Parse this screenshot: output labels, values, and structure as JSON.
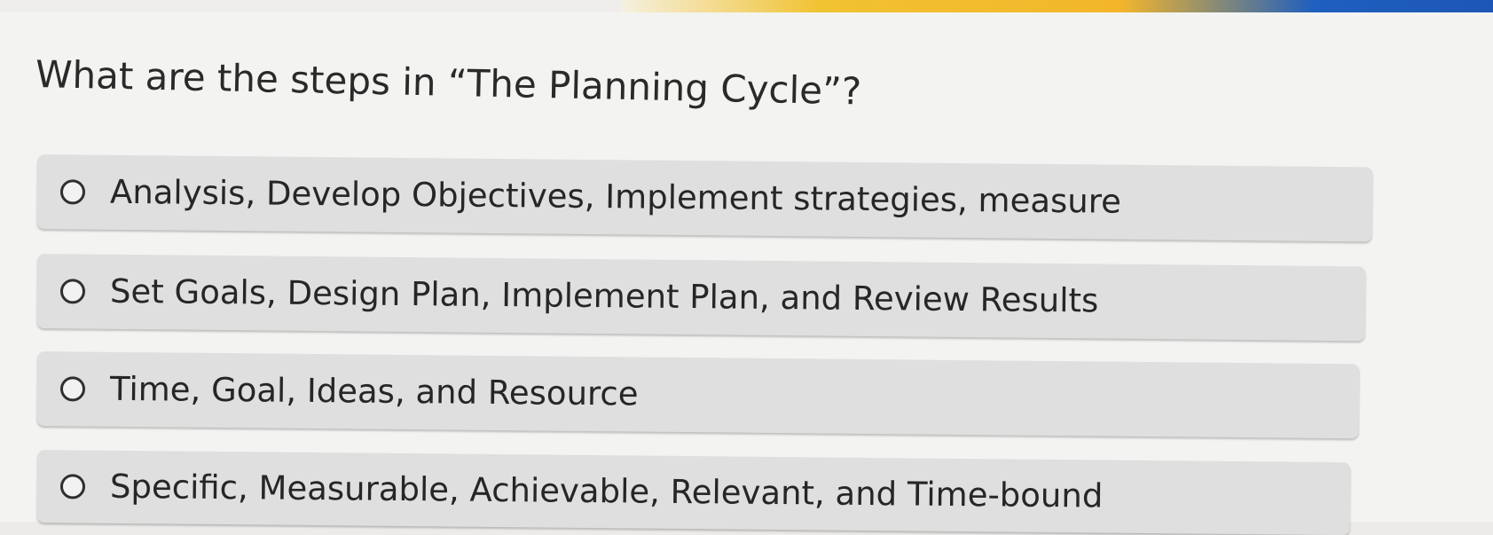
{
  "question": {
    "text": "What are the steps in “The Planning Cycle”?"
  },
  "options": [
    {
      "label": "Analysis, Develop Objectives, Implement strategies, measure"
    },
    {
      "label": "Set Goals, Design Plan, Implement Plan, and Review Results"
    },
    {
      "label": "Time, Goal, Ideas, and Resource"
    },
    {
      "label": "Specific, Measurable, Achievable, Relevant, and Time-bound"
    }
  ],
  "colors": {
    "background": "#f3f3f1",
    "option_background": "#dfdfdf",
    "text": "#222222",
    "accent_yellow": "#f1c232",
    "accent_blue": "#1f5fbf"
  },
  "icons": {
    "radio": "radio-unselected-icon"
  }
}
